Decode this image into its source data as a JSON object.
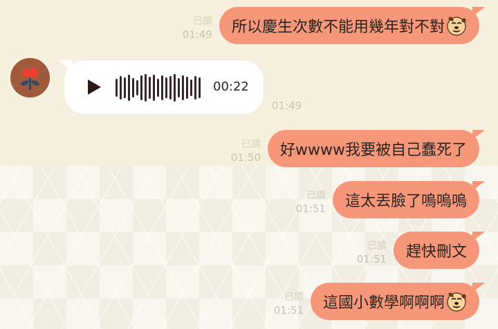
{
  "chat": {
    "messages": [
      {
        "direction": "outgoing",
        "read_label": "已讀",
        "time": "01:49",
        "text": "所以慶生次數不能用幾年對不對",
        "sticker": "cartoon-dog-sticker"
      },
      {
        "direction": "incoming",
        "type": "voice",
        "avatar": "red-flower-avatar",
        "duration": "00:22",
        "time": "01:49"
      },
      {
        "direction": "outgoing",
        "read_label": "已讀",
        "time": "01:50",
        "text": "好wwww我要被自己蠢死了"
      },
      {
        "direction": "outgoing",
        "read_label": "已讀",
        "time": "01:51",
        "text": "這太丟臉了嗚嗚嗚"
      },
      {
        "direction": "outgoing",
        "read_label": "已讀",
        "time": "01:51",
        "text": "趕快刪文"
      },
      {
        "direction": "outgoing",
        "read_label": "已讀",
        "time": "01:51",
        "text": "這國小數學啊啊啊",
        "sticker": "cartoon-dog-sticker"
      }
    ]
  },
  "colors": {
    "outgoing_bubble": "#f7977a",
    "incoming_bubble": "#ffffff",
    "top_background": "#f8f0de",
    "pattern_background": "#f8f6ef"
  }
}
